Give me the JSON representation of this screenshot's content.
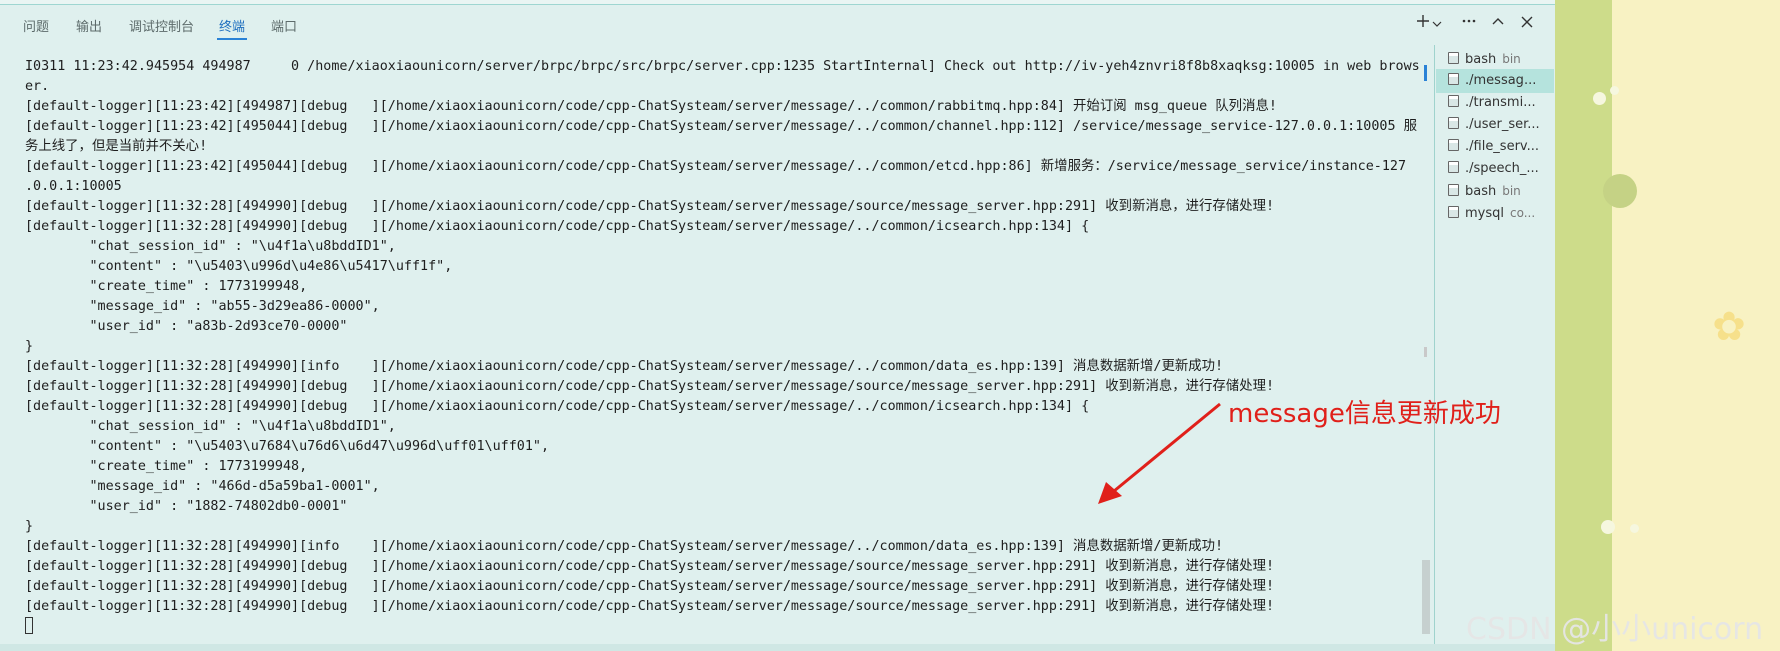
{
  "tabs": [
    {
      "label": "问题"
    },
    {
      "label": "输出"
    },
    {
      "label": "调试控制台"
    },
    {
      "label": "终端",
      "active": true
    },
    {
      "label": "端口"
    }
  ],
  "toolbar_icons": [
    "plus-icon",
    "chevron-down-icon",
    "more-icon",
    "chevron-up-icon",
    "close-icon"
  ],
  "terminal_lines": [
    "I0311 11:23:42.945954 494987     0 /home/xiaoxiaounicorn/server/brpc/brpc/src/brpc/server.cpp:1235 StartInternal] Check out http://iv-yeh4znvri8f8b8xaqksg:10005 in web brows",
    "er.",
    "[default-logger][11:23:42][494987][debug   ][/home/xiaoxiaounicorn/code/cpp-ChatSysteam/server/message/../common/rabbitmq.hpp:84] 开始订阅 msg_queue 队列消息!",
    "[default-logger][11:23:42][495044][debug   ][/home/xiaoxiaounicorn/code/cpp-ChatSysteam/server/message/../common/channel.hpp:112] /service/message_service-127.0.0.1:10005 服",
    "务上线了，但是当前并不关心!",
    "[default-logger][11:23:42][495044][debug   ][/home/xiaoxiaounicorn/code/cpp-ChatSysteam/server/message/../common/etcd.hpp:86] 新增服务：/service/message_service/instance-127",
    ".0.0.1:10005",
    "[default-logger][11:32:28][494990][debug   ][/home/xiaoxiaounicorn/code/cpp-ChatSysteam/server/message/source/message_server.hpp:291] 收到新消息，进行存储处理!",
    "[default-logger][11:32:28][494990][debug   ][/home/xiaoxiaounicorn/code/cpp-ChatSysteam/server/message/../common/icsearch.hpp:134] {",
    "        \"chat_session_id\" : \"\\u4f1a\\u8bddID1\",",
    "        \"content\" : \"\\u5403\\u996d\\u4e86\\u5417\\uff1f\",",
    "        \"create_time\" : 1773199948,",
    "        \"message_id\" : \"ab55-3d29ea86-0000\",",
    "        \"user_id\" : \"a83b-2d93ce70-0000\"",
    "}",
    "[default-logger][11:32:28][494990][info    ][/home/xiaoxiaounicorn/code/cpp-ChatSysteam/server/message/../common/data_es.hpp:139] 消息数据新增/更新成功!",
    "[default-logger][11:32:28][494990][debug   ][/home/xiaoxiaounicorn/code/cpp-ChatSysteam/server/message/source/message_server.hpp:291] 收到新消息，进行存储处理!",
    "[default-logger][11:32:28][494990][debug   ][/home/xiaoxiaounicorn/code/cpp-ChatSysteam/server/message/../common/icsearch.hpp:134] {",
    "        \"chat_session_id\" : \"\\u4f1a\\u8bddID1\",",
    "        \"content\" : \"\\u5403\\u7684\\u76d6\\u6d47\\u996d\\uff01\\uff01\",",
    "        \"create_time\" : 1773199948,",
    "        \"message_id\" : \"466d-d5a59ba1-0001\",",
    "        \"user_id\" : \"1882-74802db0-0001\"",
    "}",
    "[default-logger][11:32:28][494990][info    ][/home/xiaoxiaounicorn/code/cpp-ChatSysteam/server/message/../common/data_es.hpp:139] 消息数据新增/更新成功!",
    "[default-logger][11:32:28][494990][debug   ][/home/xiaoxiaounicorn/code/cpp-ChatSysteam/server/message/source/message_server.hpp:291] 收到新消息，进行存储处理!",
    "[default-logger][11:32:28][494990][debug   ][/home/xiaoxiaounicorn/code/cpp-ChatSysteam/server/message/source/message_server.hpp:291] 收到新消息，进行存储处理!",
    "[default-logger][11:32:28][494990][debug   ][/home/xiaoxiaounicorn/code/cpp-ChatSysteam/server/message/source/message_server.hpp:291] 收到新消息，进行存储处理!"
  ],
  "terminal_list": [
    {
      "label": "bash",
      "sub": "bin"
    },
    {
      "label": "./messag...",
      "sub": "",
      "selected": true
    },
    {
      "label": "./transmi...",
      "sub": ""
    },
    {
      "label": "./user_ser...",
      "sub": ""
    },
    {
      "label": "./file_serv...",
      "sub": ""
    },
    {
      "label": "./speech_...",
      "sub": ""
    },
    {
      "label": "bash",
      "sub": "bin"
    },
    {
      "label": "mysql",
      "sub": "co..."
    }
  ],
  "annotation": "message信息更新成功",
  "watermark": "CSDN @小小unicorn",
  "colors": {
    "active_tab": "#1f6fbf",
    "annotation": "#e0201a",
    "selected_item": "#b5e3dd"
  }
}
